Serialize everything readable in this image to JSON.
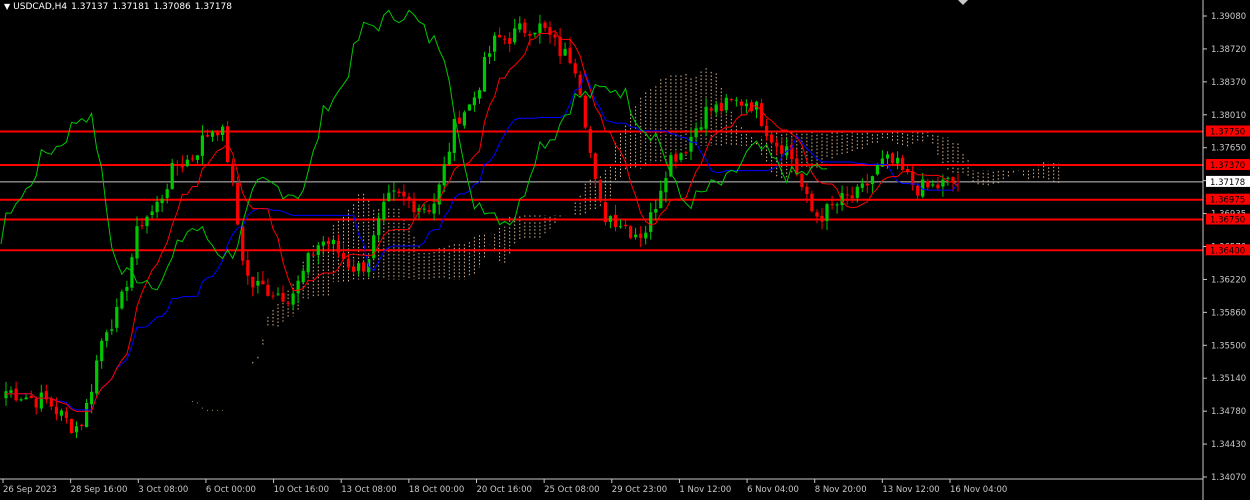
{
  "header": {
    "symbol": "USDCAD,H4",
    "open": "1.37137",
    "high": "1.37181",
    "low": "1.37086",
    "close": "1.37178"
  },
  "colors": {
    "background": "#000000",
    "axis": "#c8c8c8",
    "bull": "#00c800",
    "bear": "#ff0000",
    "tenkan": "#ff0000",
    "kijun": "#0000ff",
    "chikou": "#00c800",
    "cloud": "#f5c9a0",
    "level_line": "#ff0000",
    "current_line": "#c8c8c8"
  },
  "chart_data": {
    "type": "candlestick",
    "title": "USDCAD,H4",
    "ylim": [
      1.338,
      1.392
    ],
    "y_ticks": [
      "1.39080",
      "1.38720",
      "1.38370",
      "1.38010",
      "1.37650",
      "1.37290",
      "1.36935",
      "1.36570",
      "1.36220",
      "1.35860",
      "1.35500",
      "1.35140",
      "1.34780",
      "1.34430",
      "1.34070"
    ],
    "x_ticks": [
      "26 Sep 2023",
      "28 Sep 16:00",
      "3 Oct 08:00",
      "6 Oct 00:00",
      "10 Oct 16:00",
      "13 Oct 08:00",
      "18 Oct 00:00",
      "20 Oct 16:00",
      "25 Oct 08:00",
      "29 Oct 23:00",
      "1 Nov 12:00",
      "6 Nov 04:00",
      "8 Nov 20:00",
      "13 Nov 12:00",
      "16 Nov 04:00"
    ],
    "current_price": 1.37178,
    "current_label": "1.37178",
    "levels": [
      {
        "value": 1.3775,
        "label": "1.37750"
      },
      {
        "value": 1.3737,
        "label": "1.37370"
      },
      {
        "value": 1.36975,
        "label": "1.36975"
      },
      {
        "value": 1.3675,
        "label": "1.36750"
      },
      {
        "value": 1.364,
        "label": "1.36400"
      }
    ],
    "key_closes": [
      1.348,
      1.347,
      1.344,
      1.356,
      1.368,
      1.374,
      1.378,
      1.36,
      1.359,
      1.365,
      1.362,
      1.37,
      1.369,
      1.38,
      1.388,
      1.3895,
      1.386,
      1.368,
      1.366,
      1.375,
      1.38,
      1.381,
      1.376,
      1.368,
      1.37,
      1.374,
      1.371,
      1.37178
    ],
    "indicators": [
      "Ichimoku Kinko Hyo"
    ]
  }
}
